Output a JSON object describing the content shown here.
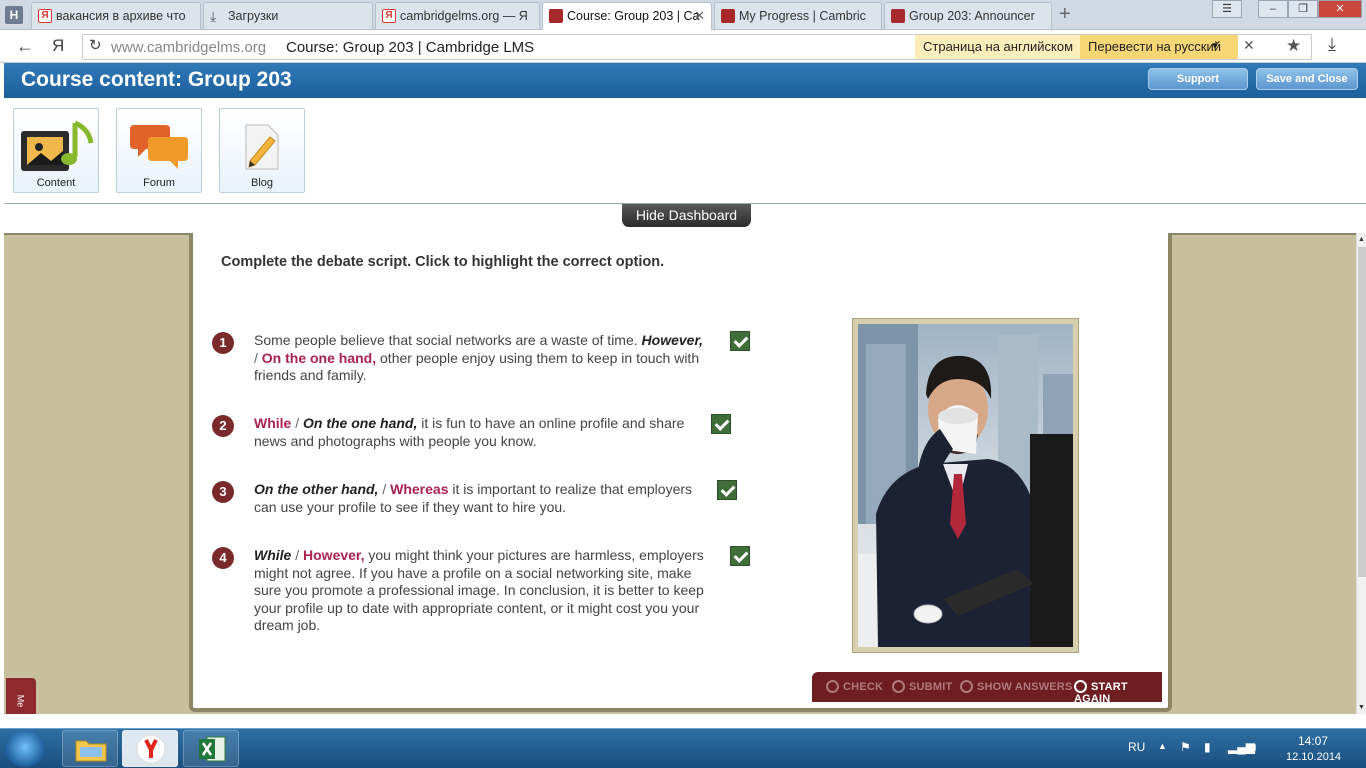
{
  "browser": {
    "tabs": [
      {
        "label": "вакансия в архиве что",
        "favicon": "yandex-icon",
        "active": false
      },
      {
        "label": "Загрузки",
        "favicon": "download-icon",
        "active": false
      },
      {
        "label": "cambridgelms.org — Я",
        "favicon": "yandex-icon",
        "active": false
      },
      {
        "label": "Course: Group 203 | Ca",
        "favicon": "cambridge-icon",
        "active": true
      },
      {
        "label": "My Progress | Cambric",
        "favicon": "cambridge-icon",
        "active": false
      },
      {
        "label": "Group 203: Announcer",
        "favicon": "cambridge-icon",
        "active": false
      }
    ],
    "home_label": "H",
    "url_host": "www.cambridgelms.org",
    "url_title": "Course: Group 203 | Cambridge LMS",
    "translate_notice": "Страница на английском",
    "translate_button": "Перевести на русский",
    "ya_label": "Я"
  },
  "lms": {
    "title": "Course content: Group 203",
    "support_label": "Support",
    "save_close_label": "Save and Close",
    "dashboard": [
      {
        "label": "Content",
        "icon": "content-icon"
      },
      {
        "label": "Forum",
        "icon": "forum-icon"
      },
      {
        "label": "Blog",
        "icon": "blog-icon"
      }
    ],
    "hide_dashboard_label": "Hide Dashboard"
  },
  "exercise": {
    "instruction": "Complete the debate script. Click to highlight the correct option.",
    "items": [
      {
        "num": "1",
        "pre": "Some people believe that social networks are a waste of time. ",
        "opt1": "However,",
        "opt2": "On the one hand,",
        "selected": 2,
        "post_line": " other people enjoy using them to keep in touch with",
        "post_rest": "friends and family."
      },
      {
        "num": "2",
        "opt1": "While",
        "opt2": "On the one hand,",
        "selected": 1,
        "post_line": " it is fun to have an online profile and share",
        "post_rest": "news and photographs with people you know."
      },
      {
        "num": "3",
        "opt1": "On the other hand,",
        "opt2": "Whereas",
        "selected": 2,
        "post_line": " it is important to realize that employers",
        "post_rest": "can use your profile to see if they want to hire you."
      },
      {
        "num": "4",
        "opt1": "While",
        "opt2": "However,",
        "selected": 2,
        "post_line": " you might think your pictures are harmless, employers",
        "post_rest": "might not agree. If you have a profile on a social networking site, make sure you promote a professional image. In conclusion, it is better to keep your profile up to date with appropriate content, or it might cost you your dream job."
      }
    ],
    "slash": "/",
    "toolbar": {
      "check": "CHECK",
      "submit": "SUBMIT",
      "show_answers": "SHOW ANSWERS",
      "start_again": "START AGAIN"
    },
    "side_tab_label": "Me"
  },
  "taskbar": {
    "lang": "RU",
    "time": "14:07",
    "date": "12.10.2014"
  },
  "colors": {
    "selected_option": "#a8244f",
    "header_blue": "#1d5f9d",
    "toolbar_maroon": "#6e1d21",
    "check_green": "#3f6e3a"
  }
}
